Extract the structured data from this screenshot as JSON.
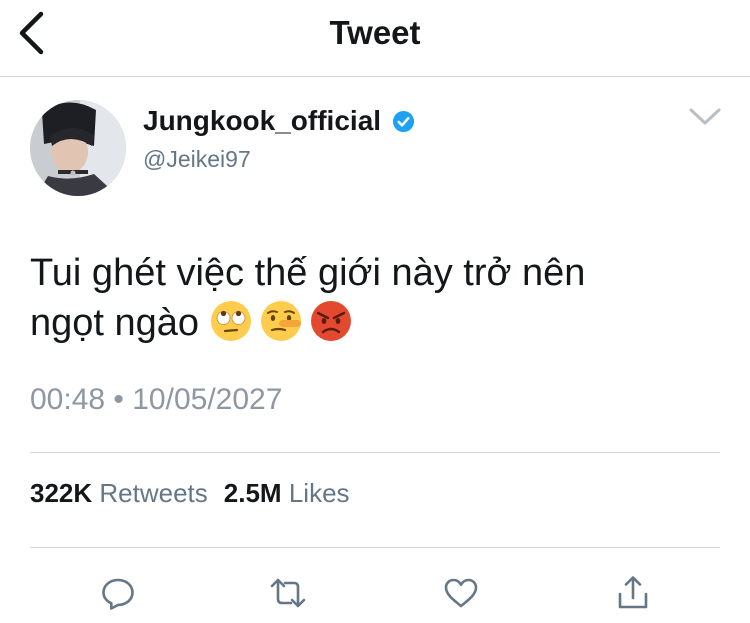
{
  "header": {
    "title": "Tweet"
  },
  "tweet": {
    "author": {
      "display_name": "Jungkook_official",
      "handle": "@Jeikei97",
      "verified": true
    },
    "text_lines": [
      "Tui ghét việc thế giới này trở nên",
      "ngọt ngào"
    ],
    "emojis": [
      "face-with-rolling-eyes",
      "lying-face",
      "pouting-face"
    ],
    "timestamp": "00:48 • 10/05/2027",
    "stats": {
      "retweets_count": "322K",
      "retweets_label": "Retweets",
      "likes_count": "2.5M",
      "likes_label": "Likes"
    }
  },
  "icons": {
    "back": "chevron-left-icon",
    "menu": "chevron-down-icon",
    "verified": "verified-badge-icon",
    "reply": "reply-icon",
    "retweet": "retweet-icon",
    "like": "heart-icon",
    "share": "share-icon"
  },
  "colors": {
    "verified": "#1da1f2",
    "text": "#14171a",
    "secondary": "#657786",
    "divider": "#d5d9dc"
  }
}
